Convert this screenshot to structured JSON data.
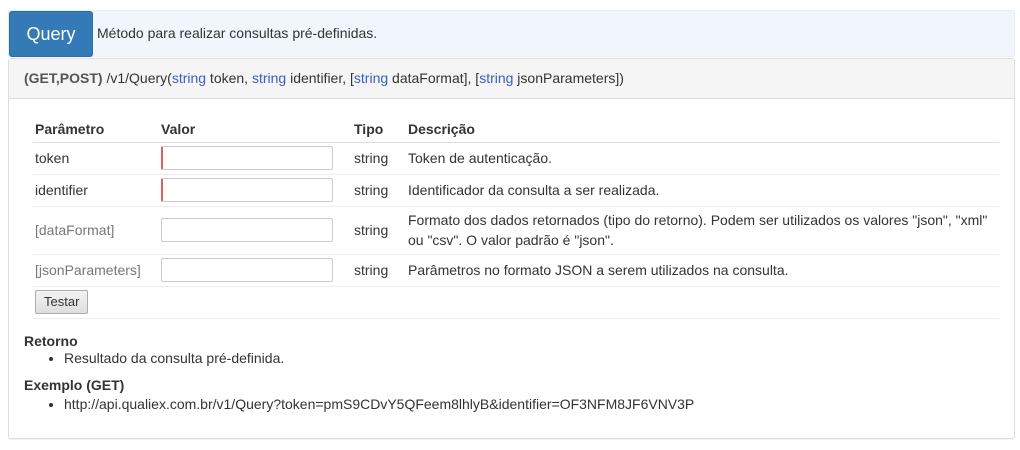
{
  "header": {
    "button_label": "Query",
    "description": "Método para realizar consultas pré-definidas."
  },
  "endpoint": {
    "methods": "(GET,POST)",
    "path": " /v1/Query(",
    "p1_type": "string",
    "p1_name": " token, ",
    "p2_type": "string",
    "p2_name": " identifier, [",
    "p3_type": "string",
    "p3_name": " dataFormat], [",
    "p4_type": "string",
    "p4_name": " jsonParameters])"
  },
  "table": {
    "headers": [
      "Parâmetro",
      "Valor",
      "Tipo",
      "Descrição"
    ],
    "rows": [
      {
        "name": "token",
        "value": "",
        "type": "string",
        "description": "Token de autenticação.",
        "required": true
      },
      {
        "name": "identifier",
        "value": "",
        "type": "string",
        "description": "Identificador da consulta a ser realizada.",
        "required": true
      },
      {
        "name": "[dataFormat]",
        "value": "",
        "type": "string",
        "description": "Formato dos dados retornados (tipo do retorno). Podem ser utilizados os valores \"json\", \"xml\" ou \"csv\". O valor padrão é \"json\".",
        "required": false
      },
      {
        "name": "[jsonParameters]",
        "value": "",
        "type": "string",
        "description": "Parâmetros no formato JSON a serem utilizados na consulta.",
        "required": false
      }
    ],
    "submit_label": "Testar"
  },
  "retorno": {
    "title": "Retorno",
    "items": [
      "Resultado da consulta pré-definida."
    ]
  },
  "exemplo": {
    "title": "Exemplo (GET)",
    "items": [
      "http://api.qualiex.com.br/v1/Query?token=pmS9CDvY5QFeem8lhlyB&identifier=OF3NFM8JF6VNV3P"
    ]
  },
  "colors": {
    "primary": "#337ab7",
    "keyword": "#3d5bc4",
    "required_marker": "#e06060"
  }
}
